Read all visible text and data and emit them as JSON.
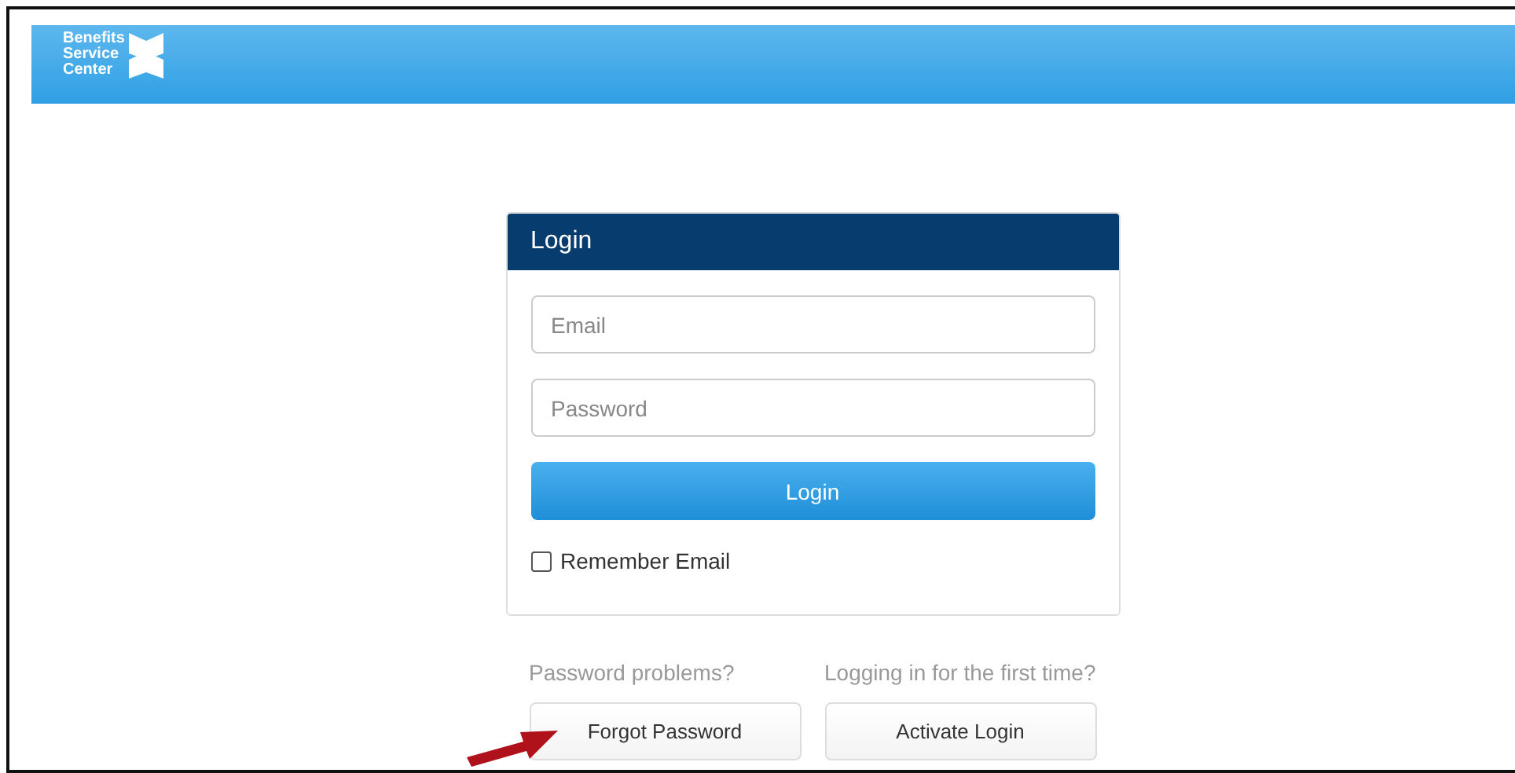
{
  "header": {
    "logo_lines": [
      "Benefits",
      "Service",
      "Center"
    ]
  },
  "login_panel": {
    "title": "Login",
    "email": {
      "placeholder": "Email"
    },
    "password": {
      "placeholder": "Password"
    },
    "submit": "Login",
    "remember": {
      "label": "Remember Email",
      "checked": false
    }
  },
  "help": [
    {
      "prompt": "Password problems?",
      "button": "Forgot Password",
      "highlighted": true
    },
    {
      "prompt": "Logging in for the first time?",
      "button": "Activate Login",
      "highlighted": false
    }
  ]
}
